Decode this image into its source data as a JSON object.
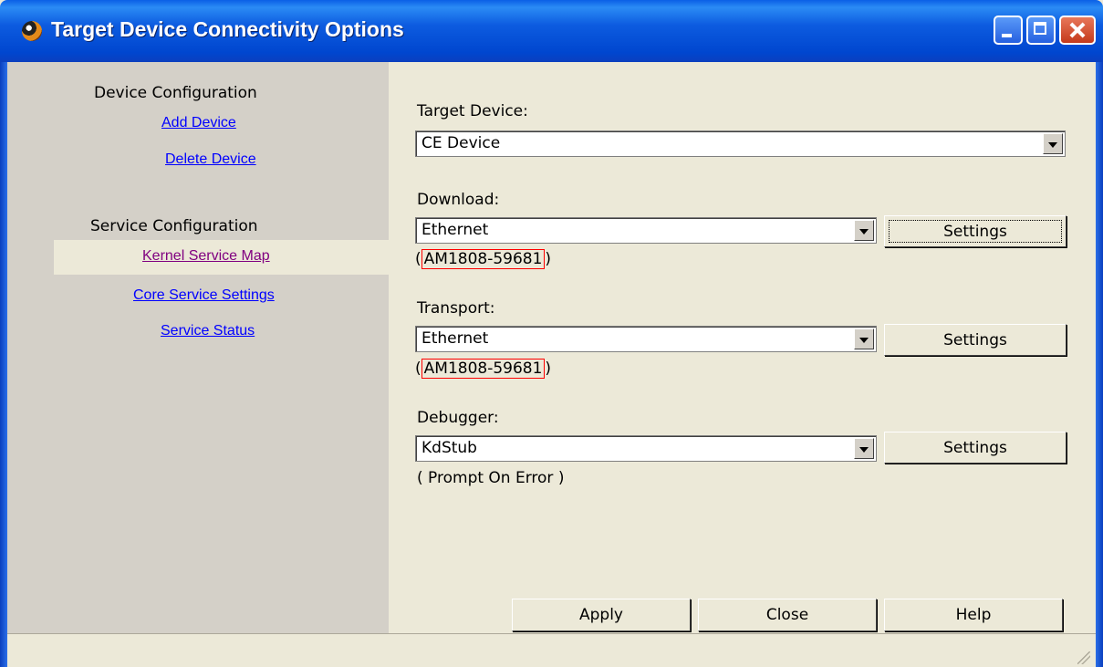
{
  "window": {
    "title": "Target Device Connectivity Options"
  },
  "sidebar": {
    "device_config_heading": "Device Configuration",
    "add_device": "Add Device",
    "delete_device": "Delete Device",
    "service_config_heading": "Service Configuration",
    "kernel_service_map": "Kernel Service Map",
    "core_service_settings": "Core Service Settings",
    "service_status": "Service Status"
  },
  "main": {
    "target_device": {
      "label": "Target Device:",
      "value": "CE Device"
    },
    "download": {
      "label": "Download:",
      "value": "Ethernet",
      "settings_label": "Settings",
      "address_open": "(",
      "address": "AM1808-59681",
      "address_close": ")"
    },
    "transport": {
      "label": "Transport:",
      "value": "Ethernet",
      "settings_label": "Settings",
      "address_open": "(",
      "address": "AM1808-59681",
      "address_close": ")"
    },
    "debugger": {
      "label": "Debugger:",
      "value": "KdStub",
      "settings_label": "Settings",
      "note": "( Prompt On Error )"
    }
  },
  "footer": {
    "apply": "Apply",
    "close": "Close",
    "help": "Help"
  },
  "colors": {
    "titlebar": "#0a5fe6",
    "link": "#0000ff",
    "visited_link": "#800080",
    "highlight_box": "#ff0000"
  }
}
